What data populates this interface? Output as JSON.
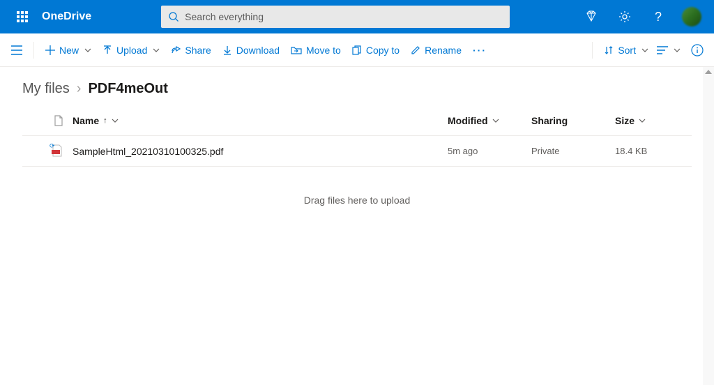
{
  "header": {
    "brand": "OneDrive",
    "search_placeholder": "Search everything"
  },
  "commands": {
    "new": "New",
    "upload": "Upload",
    "share": "Share",
    "download": "Download",
    "moveto": "Move to",
    "copyto": "Copy to",
    "rename": "Rename",
    "sort": "Sort"
  },
  "breadcrumb": {
    "root": "My files",
    "current": "PDF4meOut"
  },
  "columns": {
    "name": "Name",
    "modified": "Modified",
    "sharing": "Sharing",
    "size": "Size"
  },
  "files": [
    {
      "name": "SampleHtml_20210310100325.pdf",
      "modified": "5m ago",
      "sharing": "Private",
      "size": "18.4 KB"
    }
  ],
  "dropzone_text": "Drag files here to upload"
}
